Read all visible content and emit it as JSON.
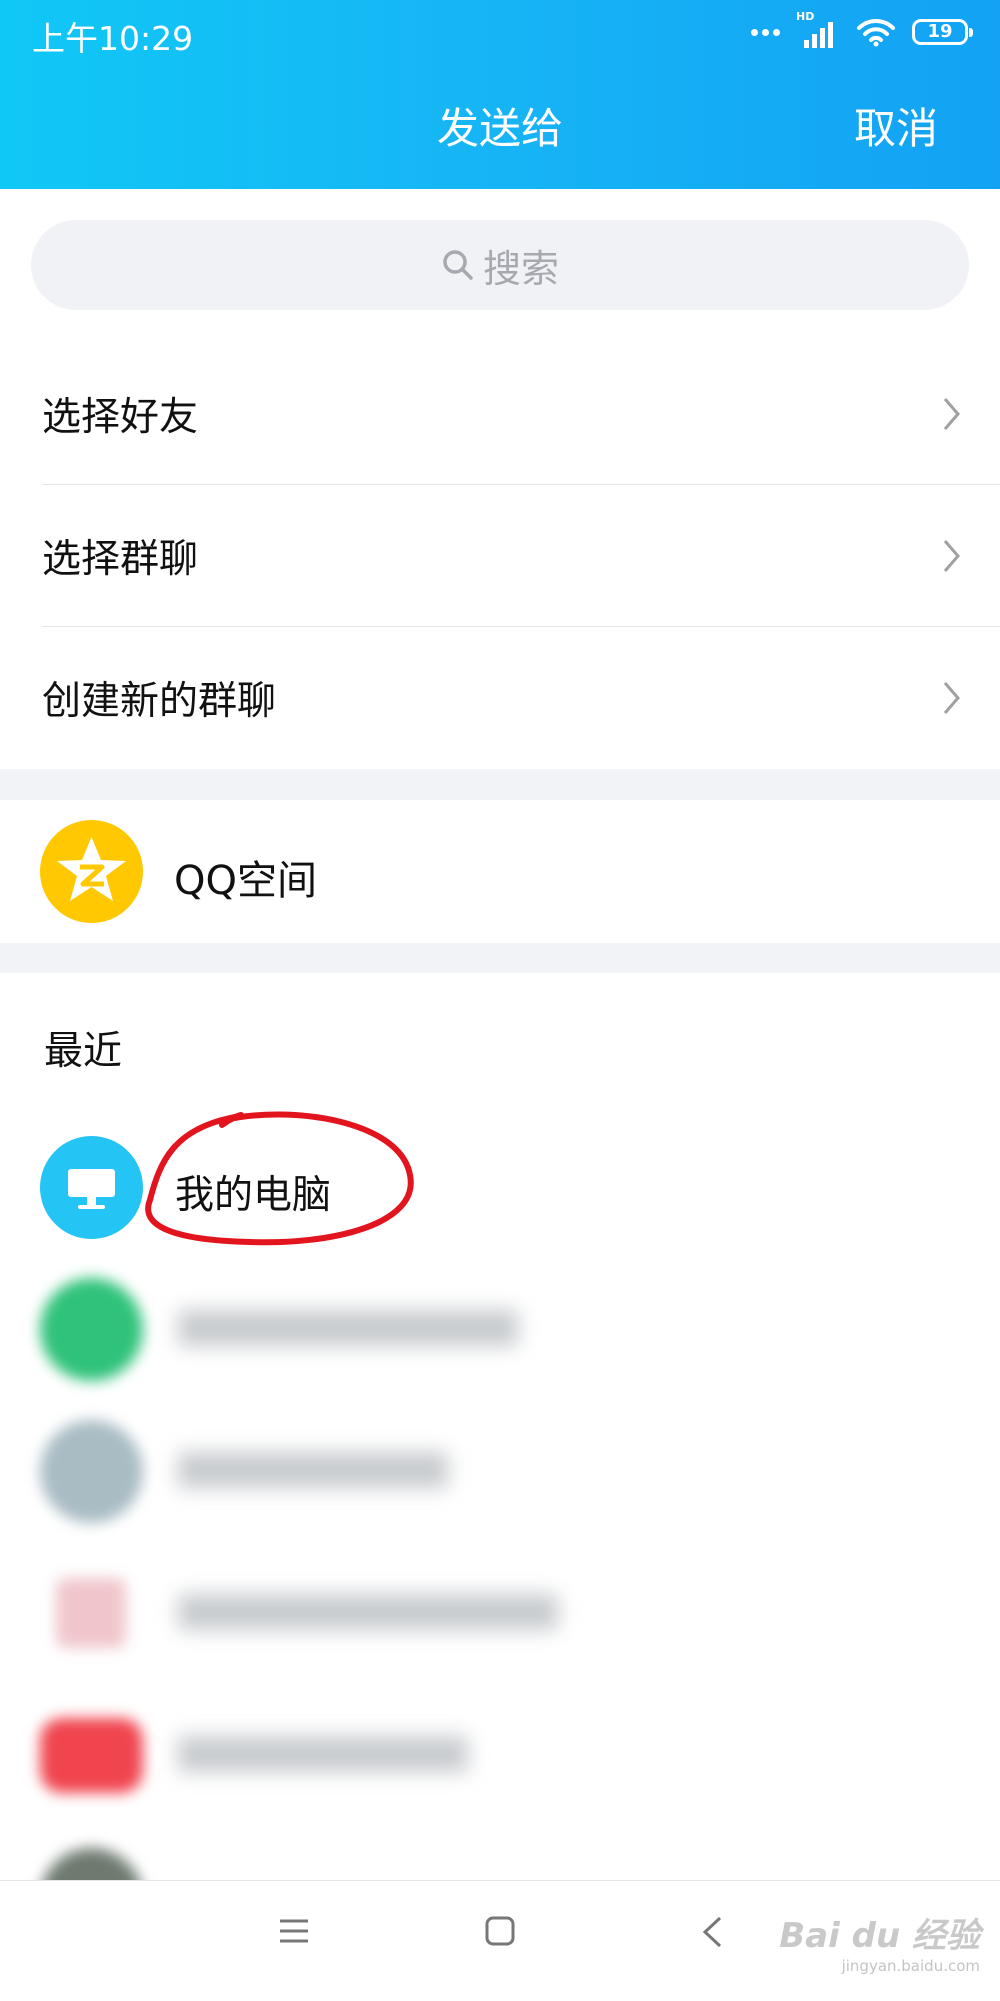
{
  "status_bar": {
    "time": "上午10:29",
    "network": "HD",
    "battery": "19"
  },
  "header": {
    "title": "发送给",
    "cancel_label": "取消"
  },
  "search": {
    "placeholder": "搜索"
  },
  "menu": [
    {
      "label": "选择好友"
    },
    {
      "label": "选择群聊"
    },
    {
      "label": "创建新的群聊"
    }
  ],
  "qzone": {
    "label": "QQ空间"
  },
  "recent": {
    "title": "最近",
    "contacts": [
      {
        "name": "我的电脑",
        "avatar_icon": "monitor-icon",
        "blurred": false
      },
      {
        "name": "",
        "blurred": true
      },
      {
        "name": "",
        "blurred": true
      },
      {
        "name": "",
        "blurred": true
      },
      {
        "name": "",
        "blurred": true
      },
      {
        "name": "",
        "blurred": true
      }
    ]
  },
  "watermark": {
    "text": "Bai du 经验",
    "url": "jingyan.baidu.com"
  },
  "colors": {
    "header_start": "#10c8f6",
    "header_end": "#13a2f4",
    "qzone_yellow": "#ffc800",
    "mypc_blue": "#24c4f4",
    "annotation_red": "#e2141d"
  }
}
